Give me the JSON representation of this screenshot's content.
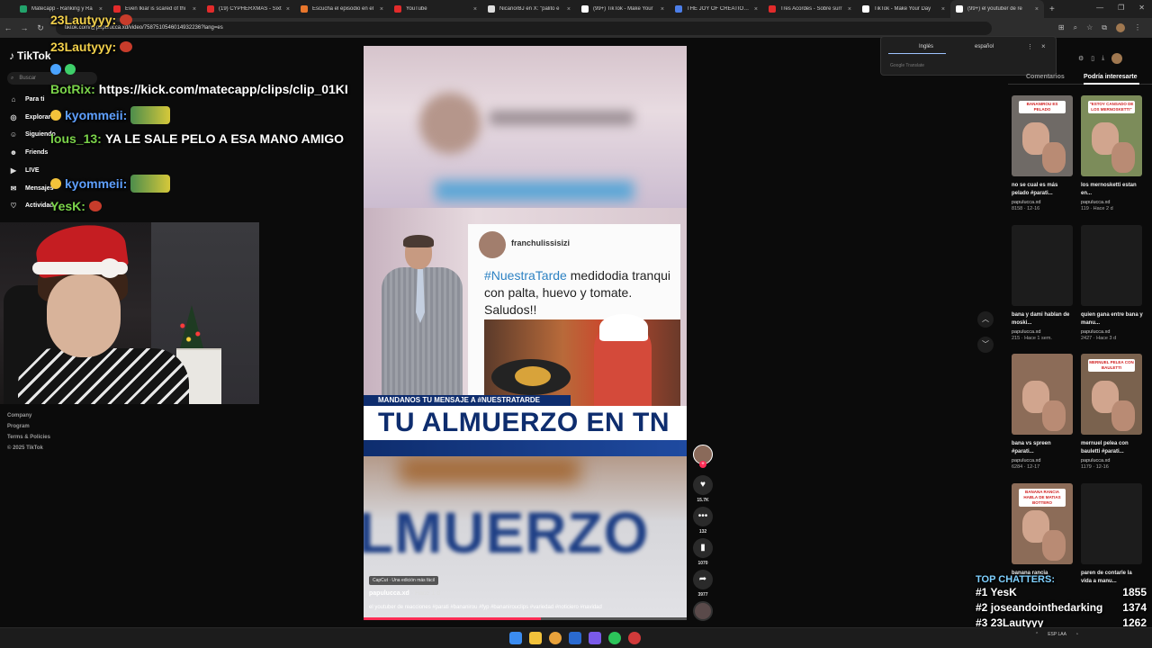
{
  "browser": {
    "tabs": [
      {
        "label": "Matecapp - Ranking y Ra",
        "color": "#22a36b",
        "active": false
      },
      {
        "label": "Even Ikiar is scared of thi",
        "color": "#e22b2b",
        "active": false
      },
      {
        "label": "(19) CYPHERXMAS - Sixt",
        "color": "#e22b2b",
        "active": false
      },
      {
        "label": "Escucha el episodio en el",
        "color": "#e8762c",
        "active": false
      },
      {
        "label": "YouTube",
        "color": "#e22b2b",
        "active": false
      },
      {
        "label": "NicanorBJ en X: \"palito e",
        "color": "#dddddd",
        "active": false
      },
      {
        "label": "(99+) TikTok - Make Your",
        "color": "#ffffff",
        "active": false
      },
      {
        "label": "THE JOY OF CREATION en",
        "color": "#4c7ee8",
        "active": false
      },
      {
        "label": "Tres Acordes - Sobre surr",
        "color": "#e22b2b",
        "active": false
      },
      {
        "label": "TikTok - Make Your Day",
        "color": "#ffffff",
        "active": false
      },
      {
        "label": "(99+) el youtuber de re",
        "color": "#ffffff",
        "active": true
      }
    ],
    "url": "tiktok.com/@papulucca.xd/video/7587510546014932236?lang=es"
  },
  "tiktok": {
    "logo_text": "TikTok",
    "search_placeholder": "Buscar",
    "nav": [
      {
        "label": "Para ti",
        "icon": "home-icon"
      },
      {
        "label": "Explorar",
        "icon": "compass-icon"
      },
      {
        "label": "Siguiendo",
        "icon": "following-icon"
      },
      {
        "label": "Friends",
        "icon": "friends-icon"
      },
      {
        "label": "LIVE",
        "icon": "live-icon"
      },
      {
        "label": "Mensajes",
        "icon": "messages-icon"
      },
      {
        "label": "Actividad",
        "icon": "activity-icon"
      }
    ],
    "footer": [
      "Company",
      "Program",
      "Terms & Policies",
      "© 2025 TikTok"
    ]
  },
  "chat": [
    {
      "user": "23Lautyyy:",
      "color": "#f2d04b",
      "msg": "",
      "emote": "small"
    },
    {
      "user": "23Lautyyy:",
      "color": "#f2d04b",
      "msg": "",
      "emote": "small"
    },
    {
      "user": "",
      "color": "#4aa3ff",
      "msg": "",
      "emote": "none",
      "badges": true
    },
    {
      "user": "BotRix:",
      "color": "#7bd44a",
      "msg": "https://kick.com/matecapp/clips/clip_01KI",
      "emote": "none"
    },
    {
      "user": "kyommeii:",
      "color": "#5fa0ff",
      "msg": "",
      "emote": "big"
    },
    {
      "user": "lous_13:",
      "color": "#7bd44a",
      "msg": "YA LE SALE PELO A ESA MANO AMIGO",
      "emote": "none"
    },
    {
      "user": "kyommeii:",
      "color": "#5fa0ff",
      "msg": "",
      "emote": "big"
    },
    {
      "user": "YesK:",
      "color": "#7bd44a",
      "msg": "",
      "emote": "small"
    }
  ],
  "video": {
    "card_user": "franchulissisizi",
    "card_hashtag": "#NuestraTarde",
    "card_text": "medidodia tranqui con palta, huevo y tomate. Saludos!!",
    "banner_top": "MANDANOS TU MENSAJE A #NUESTRATARDE",
    "banner": "TU ALMUERZO EN TN",
    "bottom_word": "LMUERZO",
    "capcut": "CapCut · Una edición más fácil",
    "author": "papulucca.xd",
    "posted": "· Hace 1 d",
    "description": "el youtuber de reacciones #parati #bananirou #fyp #bananirouclips #variedad #noticiero #navidad",
    "progress": 0.55
  },
  "actions": {
    "likes": "15.7K",
    "comments": "132",
    "saves": "1070",
    "shares": "3977"
  },
  "translate": {
    "lang_a": "Inglés",
    "lang_b": "español",
    "brand": "Google Translate"
  },
  "right_panel": {
    "tab_comments": "Comentarios",
    "tab_interest": "Podría interesarte",
    "cards": [
      {
        "title": "no se cual es más pelado #parati...",
        "author": "papulucca.xd",
        "stats": "8158 · 12-16",
        "tag": "BANANIROU ES PELADO",
        "thumb": "#6f6a66"
      },
      {
        "title": "los mernosketti estan en...",
        "author": "papulucca.xd",
        "stats": "119 · Hace 2 d",
        "tag": "\"ESTOY CANSADO DE LOS MERNOSKETTI\"",
        "thumb": "#7c8c5a"
      },
      {
        "title": "bana y dami hablan de moski...",
        "author": "papulucca.xd",
        "stats": "215 · Hace 1 sem.",
        "tag": "",
        "thumb": "#1c1c1c"
      },
      {
        "title": "quien gana entre bana y manu...",
        "author": "papulucca.xd",
        "stats": "2427 · Hace 3 d",
        "tag": "",
        "thumb": "#1c1c1c"
      },
      {
        "title": "bana vs spreen #parati...",
        "author": "papulucca.xd",
        "stats": "6284 · 12-17",
        "tag": "",
        "thumb": "#8c6c58"
      },
      {
        "title": "mernuel pelea con bauletti #parati...",
        "author": "papulucca.xd",
        "stats": "1179 · 12-16",
        "tag": "MERNUEL PELEA CON BAULETTI",
        "thumb": "#7a624e"
      },
      {
        "title": "banana rancia",
        "author": "",
        "stats": "",
        "tag": "BANANA RANCIA HABLA DE MATIAS BOTTERO",
        "thumb": "#8c6c58"
      },
      {
        "title": "paren de contarle la vida a manu...",
        "author": "",
        "stats": "",
        "tag": "",
        "thumb": "#1c1c1c"
      }
    ]
  },
  "top_chatters": {
    "title": "TOP CHATTERS:",
    "rows": [
      {
        "rank": "#1",
        "name": "YesK",
        "count": "1855"
      },
      {
        "rank": "#2",
        "name": "joseandointhedarking",
        "count": "1374"
      },
      {
        "rank": "#3",
        "name": "23Lautyyy",
        "count": "1262"
      }
    ]
  },
  "taskbar": {
    "lang": "ESP LAA"
  }
}
